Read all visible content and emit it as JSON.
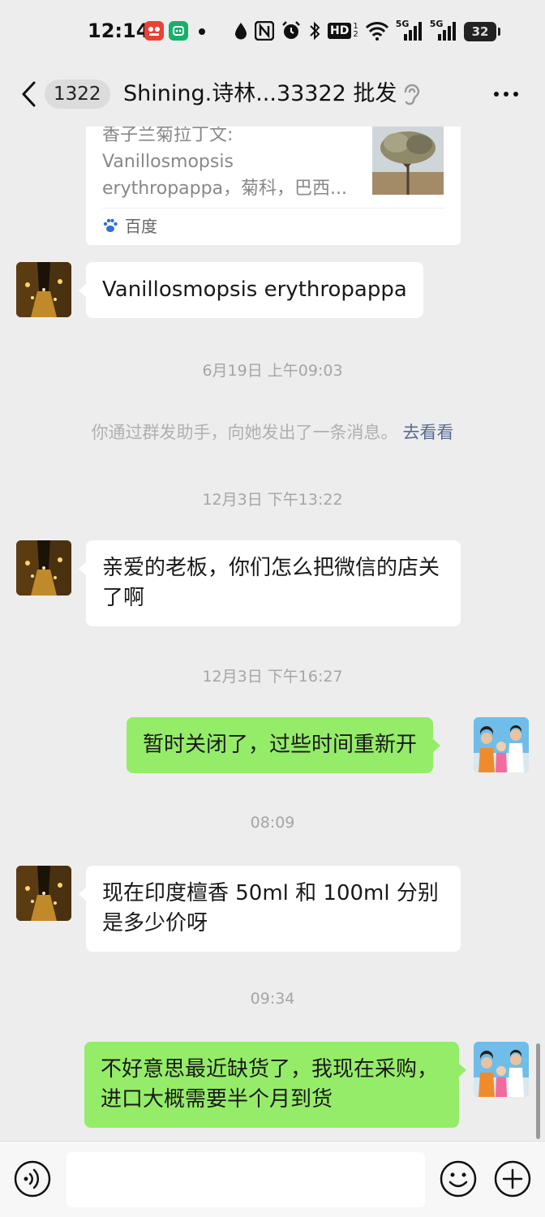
{
  "status_bar": {
    "time": "12:14",
    "network_labels": [
      "HD",
      "5G",
      "5G"
    ],
    "battery": "32",
    "icons": [
      "app-icon-red",
      "app-icon-green",
      "dot",
      "drop-icon",
      "nfc-icon",
      "alarm-icon",
      "bluetooth-icon",
      "hd-icon",
      "wifi-icon",
      "signal-icon",
      "signal-icon",
      "battery-icon"
    ]
  },
  "nav": {
    "back_icon": "chevron-left-icon",
    "unread_count": "1322",
    "title": "Shining.诗林...33322 批发",
    "ear_icon": "ear-icon",
    "more_icon": "more-icon"
  },
  "messages": {
    "card": {
      "description": "香子兰菊拉丁文:\nVanillosmopsis\nerythropappa，菊科，巴西...",
      "thumb": "tree-image",
      "source": "百度",
      "source_icon": "paw-icon"
    },
    "m1": {
      "side": "left",
      "text": "Vanillosmopsis erythropappa"
    },
    "ts1": "6月19日 上午09:03",
    "system": {
      "text": "你通过群发助手，向她发出了一条消息。",
      "link": "去看看"
    },
    "ts2": "12月3日 下午13:22",
    "m2": {
      "side": "left",
      "text": "亲爱的老板，你们怎么把微信的店关了啊"
    },
    "ts3": "12月3日 下午16:27",
    "m3": {
      "side": "right",
      "text": "暂时关闭了，过些时间重新开"
    },
    "ts4": "08:09",
    "m4": {
      "side": "left",
      "text": "现在印度檀香 50ml 和 100ml 分别是多少价呀"
    },
    "ts5": "09:34",
    "m5": {
      "side": "right",
      "text": "不好意思最近缺货了，我现在采购，进口大概需要半个月到货"
    }
  },
  "input_bar": {
    "value": "",
    "placeholder": "",
    "icons": [
      "voice-icon",
      "emoji-icon",
      "plus-icon"
    ]
  },
  "colors": {
    "background": "#ededed",
    "bubble_self": "#95ec69",
    "bubble_other": "#ffffff",
    "link": "#576b95"
  }
}
